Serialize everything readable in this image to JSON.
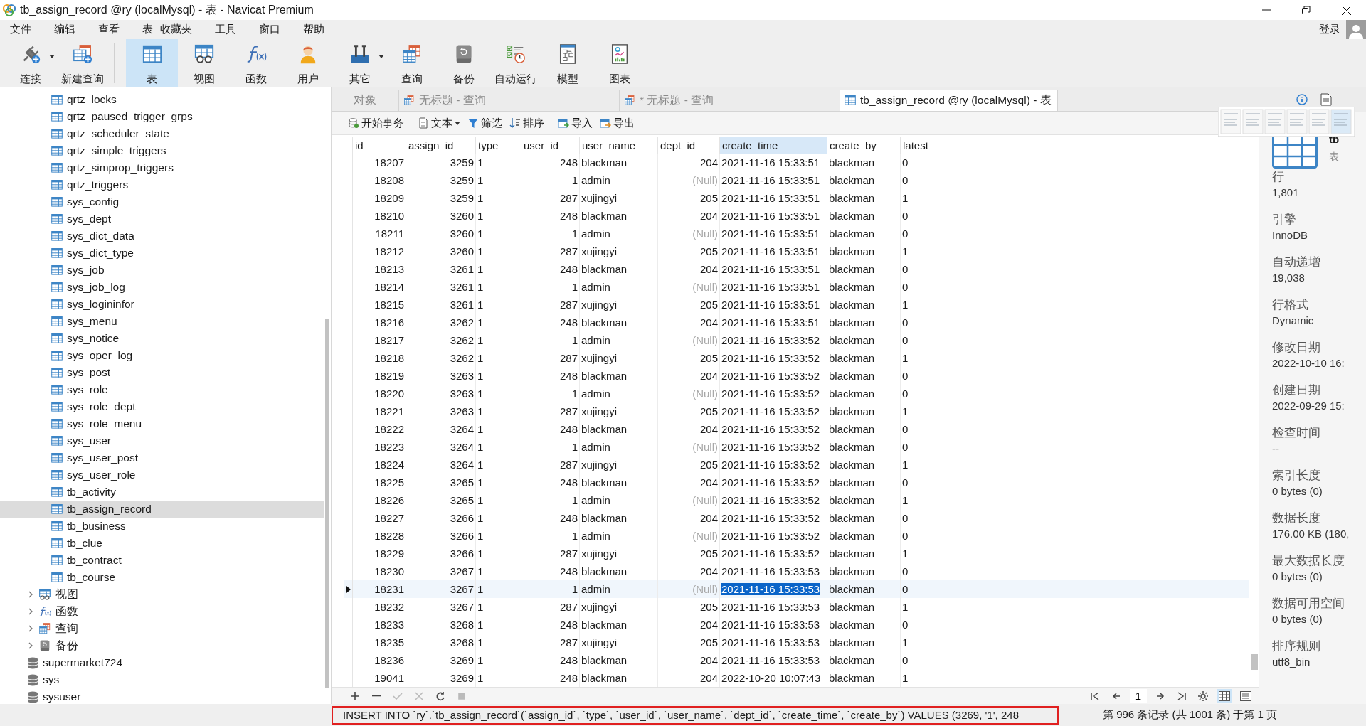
{
  "window": {
    "title": "tb_assign_record @ry (localMysql) - 表 - Navicat Premium"
  },
  "menu": [
    "文件",
    "编辑",
    "查看",
    "表",
    "收藏夹",
    "工具",
    "窗口",
    "帮助"
  ],
  "login": "登录",
  "toolbar": [
    {
      "label": "连接",
      "kind": "connect",
      "dropdown": true,
      "selected": false
    },
    {
      "label": "新建查询",
      "kind": "new_query",
      "dropdown": false,
      "selected": false
    },
    {
      "label": "表",
      "kind": "table",
      "dropdown": false,
      "selected": true
    },
    {
      "label": "视图",
      "kind": "view",
      "dropdown": false,
      "selected": false
    },
    {
      "label": "函数",
      "kind": "function",
      "dropdown": false,
      "selected": false
    },
    {
      "label": "用户",
      "kind": "user",
      "dropdown": false,
      "selected": false
    },
    {
      "label": "其它",
      "kind": "other",
      "dropdown": true,
      "selected": false
    },
    {
      "label": "查询",
      "kind": "query",
      "dropdown": false,
      "selected": false
    },
    {
      "label": "备份",
      "kind": "backup",
      "dropdown": false,
      "selected": false
    },
    {
      "label": "自动运行",
      "kind": "automation",
      "dropdown": false,
      "selected": false
    },
    {
      "label": "模型",
      "kind": "model",
      "dropdown": false,
      "selected": false
    },
    {
      "label": "图表",
      "kind": "chart",
      "dropdown": false,
      "selected": false
    }
  ],
  "sidebar": {
    "tables": [
      {
        "label": "qrtz_locks",
        "selected": false
      },
      {
        "label": "qrtz_paused_trigger_grps",
        "selected": false
      },
      {
        "label": "qrtz_scheduler_state",
        "selected": false
      },
      {
        "label": "qrtz_simple_triggers",
        "selected": false
      },
      {
        "label": "qrtz_simprop_triggers",
        "selected": false
      },
      {
        "label": "qrtz_triggers",
        "selected": false
      },
      {
        "label": "sys_config",
        "selected": false
      },
      {
        "label": "sys_dept",
        "selected": false
      },
      {
        "label": "sys_dict_data",
        "selected": false
      },
      {
        "label": "sys_dict_type",
        "selected": false
      },
      {
        "label": "sys_job",
        "selected": false
      },
      {
        "label": "sys_job_log",
        "selected": false
      },
      {
        "label": "sys_logininfor",
        "selected": false
      },
      {
        "label": "sys_menu",
        "selected": false
      },
      {
        "label": "sys_notice",
        "selected": false
      },
      {
        "label": "sys_oper_log",
        "selected": false
      },
      {
        "label": "sys_post",
        "selected": false
      },
      {
        "label": "sys_role",
        "selected": false
      },
      {
        "label": "sys_role_dept",
        "selected": false
      },
      {
        "label": "sys_role_menu",
        "selected": false
      },
      {
        "label": "sys_user",
        "selected": false
      },
      {
        "label": "sys_user_post",
        "selected": false
      },
      {
        "label": "sys_user_role",
        "selected": false
      },
      {
        "label": "tb_activity",
        "selected": false
      },
      {
        "label": "tb_assign_record",
        "selected": true
      },
      {
        "label": "tb_business",
        "selected": false
      },
      {
        "label": "tb_clue",
        "selected": false
      },
      {
        "label": "tb_contract",
        "selected": false
      },
      {
        "label": "tb_course",
        "selected": false
      }
    ],
    "groups": [
      {
        "label": "视图",
        "kind": "view",
        "expanded": false
      },
      {
        "label": "函数",
        "kind": "function",
        "expanded": false
      },
      {
        "label": "查询",
        "kind": "query",
        "expanded": false
      },
      {
        "label": "备份",
        "kind": "backup",
        "expanded": false
      }
    ],
    "databases": [
      {
        "label": "supermarket724"
      },
      {
        "label": "sys"
      },
      {
        "label": "sysuser"
      }
    ]
  },
  "tabs": [
    {
      "label": "对象",
      "kind": "objects",
      "selected": false
    },
    {
      "label": "无标题 - 查询",
      "kind": "query",
      "selected": false
    },
    {
      "label": "* 无标题 - 查询",
      "kind": "query",
      "selected": false
    },
    {
      "label": "tb_assign_record @ry (localMysql) - 表",
      "kind": "table",
      "selected": true
    }
  ],
  "table_toolbar": [
    {
      "label": "开始事务",
      "kind": "transaction",
      "dropdown": false
    },
    {
      "label": "文本",
      "kind": "text",
      "dropdown": true
    },
    {
      "label": "筛选",
      "kind": "filter",
      "dropdown": false
    },
    {
      "label": "排序",
      "kind": "sort",
      "dropdown": false
    },
    {
      "label": "导入",
      "kind": "import",
      "dropdown": false
    },
    {
      "label": "导出",
      "kind": "export",
      "dropdown": false
    }
  ],
  "table": {
    "columns": [
      {
        "label": "id",
        "selected": false
      },
      {
        "label": "assign_id",
        "selected": false
      },
      {
        "label": "type",
        "selected": false
      },
      {
        "label": "user_id",
        "selected": false
      },
      {
        "label": "user_name",
        "selected": false
      },
      {
        "label": "dept_id",
        "selected": false
      },
      {
        "label": "create_time",
        "selected": true
      },
      {
        "label": "create_by",
        "selected": false
      },
      {
        "label": "latest",
        "selected": false
      }
    ],
    "rows": [
      {
        "cells": [
          "18207",
          "3259",
          "1",
          "248",
          "blackman",
          "204",
          "2021-11-16 15:33:51",
          "blackman",
          "0"
        ],
        "dept_null": false,
        "selected": false
      },
      {
        "cells": [
          "18208",
          "3259",
          "1",
          "1",
          "admin",
          "(Null)",
          "2021-11-16 15:33:51",
          "blackman",
          "0"
        ],
        "dept_null": true,
        "selected": false
      },
      {
        "cells": [
          "18209",
          "3259",
          "1",
          "287",
          "xujingyi",
          "205",
          "2021-11-16 15:33:51",
          "blackman",
          "1"
        ],
        "dept_null": false,
        "selected": false
      },
      {
        "cells": [
          "18210",
          "3260",
          "1",
          "248",
          "blackman",
          "204",
          "2021-11-16 15:33:51",
          "blackman",
          "0"
        ],
        "dept_null": false,
        "selected": false
      },
      {
        "cells": [
          "18211",
          "3260",
          "1",
          "1",
          "admin",
          "(Null)",
          "2021-11-16 15:33:51",
          "blackman",
          "0"
        ],
        "dept_null": true,
        "selected": false
      },
      {
        "cells": [
          "18212",
          "3260",
          "1",
          "287",
          "xujingyi",
          "205",
          "2021-11-16 15:33:51",
          "blackman",
          "1"
        ],
        "dept_null": false,
        "selected": false
      },
      {
        "cells": [
          "18213",
          "3261",
          "1",
          "248",
          "blackman",
          "204",
          "2021-11-16 15:33:51",
          "blackman",
          "0"
        ],
        "dept_null": false,
        "selected": false
      },
      {
        "cells": [
          "18214",
          "3261",
          "1",
          "1",
          "admin",
          "(Null)",
          "2021-11-16 15:33:51",
          "blackman",
          "0"
        ],
        "dept_null": true,
        "selected": false
      },
      {
        "cells": [
          "18215",
          "3261",
          "1",
          "287",
          "xujingyi",
          "205",
          "2021-11-16 15:33:51",
          "blackman",
          "1"
        ],
        "dept_null": false,
        "selected": false
      },
      {
        "cells": [
          "18216",
          "3262",
          "1",
          "248",
          "blackman",
          "204",
          "2021-11-16 15:33:51",
          "blackman",
          "0"
        ],
        "dept_null": false,
        "selected": false
      },
      {
        "cells": [
          "18217",
          "3262",
          "1",
          "1",
          "admin",
          "(Null)",
          "2021-11-16 15:33:52",
          "blackman",
          "0"
        ],
        "dept_null": true,
        "selected": false
      },
      {
        "cells": [
          "18218",
          "3262",
          "1",
          "287",
          "xujingyi",
          "205",
          "2021-11-16 15:33:52",
          "blackman",
          "1"
        ],
        "dept_null": false,
        "selected": false
      },
      {
        "cells": [
          "18219",
          "3263",
          "1",
          "248",
          "blackman",
          "204",
          "2021-11-16 15:33:52",
          "blackman",
          "0"
        ],
        "dept_null": false,
        "selected": false
      },
      {
        "cells": [
          "18220",
          "3263",
          "1",
          "1",
          "admin",
          "(Null)",
          "2021-11-16 15:33:52",
          "blackman",
          "0"
        ],
        "dept_null": true,
        "selected": false
      },
      {
        "cells": [
          "18221",
          "3263",
          "1",
          "287",
          "xujingyi",
          "205",
          "2021-11-16 15:33:52",
          "blackman",
          "1"
        ],
        "dept_null": false,
        "selected": false
      },
      {
        "cells": [
          "18222",
          "3264",
          "1",
          "248",
          "blackman",
          "204",
          "2021-11-16 15:33:52",
          "blackman",
          "0"
        ],
        "dept_null": false,
        "selected": false
      },
      {
        "cells": [
          "18223",
          "3264",
          "1",
          "1",
          "admin",
          "(Null)",
          "2021-11-16 15:33:52",
          "blackman",
          "0"
        ],
        "dept_null": true,
        "selected": false
      },
      {
        "cells": [
          "18224",
          "3264",
          "1",
          "287",
          "xujingyi",
          "205",
          "2021-11-16 15:33:52",
          "blackman",
          "1"
        ],
        "dept_null": false,
        "selected": false
      },
      {
        "cells": [
          "18225",
          "3265",
          "1",
          "248",
          "blackman",
          "204",
          "2021-11-16 15:33:52",
          "blackman",
          "0"
        ],
        "dept_null": false,
        "selected": false
      },
      {
        "cells": [
          "18226",
          "3265",
          "1",
          "1",
          "admin",
          "(Null)",
          "2021-11-16 15:33:52",
          "blackman",
          "1"
        ],
        "dept_null": true,
        "selected": false
      },
      {
        "cells": [
          "18227",
          "3266",
          "1",
          "248",
          "blackman",
          "204",
          "2021-11-16 15:33:52",
          "blackman",
          "0"
        ],
        "dept_null": false,
        "selected": false
      },
      {
        "cells": [
          "18228",
          "3266",
          "1",
          "1",
          "admin",
          "(Null)",
          "2021-11-16 15:33:52",
          "blackman",
          "0"
        ],
        "dept_null": true,
        "selected": false
      },
      {
        "cells": [
          "18229",
          "3266",
          "1",
          "287",
          "xujingyi",
          "205",
          "2021-11-16 15:33:52",
          "blackman",
          "1"
        ],
        "dept_null": false,
        "selected": false
      },
      {
        "cells": [
          "18230",
          "3267",
          "1",
          "248",
          "blackman",
          "204",
          "2021-11-16 15:33:53",
          "blackman",
          "0"
        ],
        "dept_null": false,
        "selected": false
      },
      {
        "cells": [
          "18231",
          "3267",
          "1",
          "1",
          "admin",
          "(Null)",
          "2021-11-16 15:33:53",
          "blackman",
          "0"
        ],
        "dept_null": true,
        "selected": true
      },
      {
        "cells": [
          "18232",
          "3267",
          "1",
          "287",
          "xujingyi",
          "205",
          "2021-11-16 15:33:53",
          "blackman",
          "1"
        ],
        "dept_null": false,
        "selected": false
      },
      {
        "cells": [
          "18233",
          "3268",
          "1",
          "248",
          "blackman",
          "204",
          "2021-11-16 15:33:53",
          "blackman",
          "0"
        ],
        "dept_null": false,
        "selected": false
      },
      {
        "cells": [
          "18235",
          "3268",
          "1",
          "287",
          "xujingyi",
          "205",
          "2021-11-16 15:33:53",
          "blackman",
          "1"
        ],
        "dept_null": false,
        "selected": false
      },
      {
        "cells": [
          "18236",
          "3269",
          "1",
          "248",
          "blackman",
          "204",
          "2021-11-16 15:33:53",
          "blackman",
          "0"
        ],
        "dept_null": false,
        "selected": false
      },
      {
        "cells": [
          "19041",
          "3269",
          "1",
          "248",
          "blackman",
          "204",
          "2022-10-20 10:07:43",
          "blackman",
          "1"
        ],
        "dept_null": false,
        "selected": false
      }
    ]
  },
  "navigator": {
    "page": "1"
  },
  "info_panel": {
    "name": "tb",
    "type": "表",
    "properties": [
      {
        "label": "行",
        "value": "1,801"
      },
      {
        "label": "引擎",
        "value": "InnoDB"
      },
      {
        "label": "自动递增",
        "value": "19,038"
      },
      {
        "label": "行格式",
        "value": "Dynamic"
      },
      {
        "label": "修改日期",
        "value": "2022-10-10 16:"
      },
      {
        "label": "创建日期",
        "value": "2022-09-29 15:"
      },
      {
        "label": "检查时间",
        "value": "--"
      },
      {
        "label": "索引长度",
        "value": "0 bytes (0)"
      },
      {
        "label": "数据长度",
        "value": "176.00 KB (180,"
      },
      {
        "label": "最大数据长度",
        "value": "0 bytes (0)"
      },
      {
        "label": "数据可用空间",
        "value": "0 bytes (0)"
      },
      {
        "label": "排序规则",
        "value": "utf8_bin"
      }
    ]
  },
  "status_bar": {
    "sql": "INSERT INTO `ry`.`tb_assign_record`(`assign_id`, `type`, `user_id`, `user_name`, `dept_id`, `create_time`, `create_by`) VALUES (3269, '1', 248",
    "record": "第 996 条记录 (共 1001 条) 于第 1 页"
  }
}
